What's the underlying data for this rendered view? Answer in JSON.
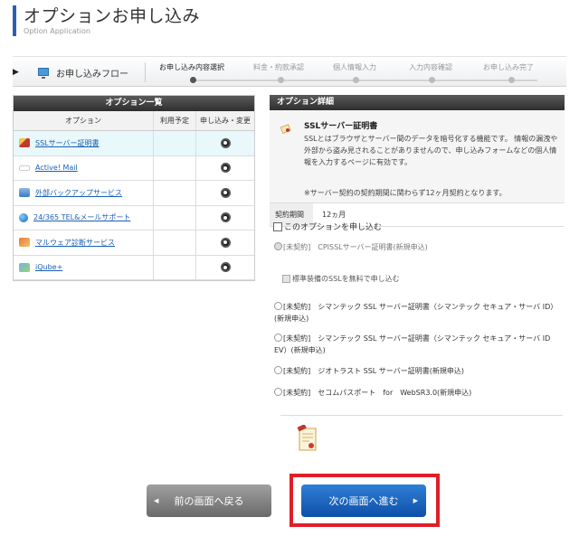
{
  "header": {
    "title": "オプションお申し込み",
    "subtitle": "Option Application"
  },
  "flow": {
    "label": "お申し込みフロー",
    "steps": [
      "お申し込み内容選択",
      "料金・約款承認",
      "個人情報入力",
      "入力内容確認",
      "お申し込み完了"
    ],
    "current_step": "お申し込み内容選択"
  },
  "options_panel": {
    "title": "オプション一覧",
    "columns": [
      "オプション",
      "利用予定",
      "申し込み・変更"
    ],
    "rows": [
      {
        "name": "SSLサーバー証明書",
        "icon": "certificate-icon",
        "selected": true
      },
      {
        "name": "Active! Mail",
        "icon": "active-mail-logo",
        "selected": false
      },
      {
        "name": "外部バックアップサービス",
        "icon": "backup-icon",
        "selected": false
      },
      {
        "name": "24/365 TEL&メールサポート",
        "icon": "support-globe-icon",
        "selected": false
      },
      {
        "name": "マルウェア診断サービス",
        "icon": "malware-scan-icon",
        "selected": false
      },
      {
        "name": "iQube+",
        "icon": "iqube-icon",
        "selected": false
      }
    ]
  },
  "detail_panel": {
    "title": "オプション詳細",
    "name": "SSLサーバー証明書",
    "description": "SSLとはブラウザとサーバー間のデータを暗号化する機能です。 情報の漏洩や外部から盗み見されることがありませんので、申し込みフォームなどの個人情報を入力するページに有効です。",
    "note": "※サーバー契約の契約期間に関わらず12ヶ月契約となります。",
    "contract_label": "契約期間",
    "contract_value": "12ヵ月",
    "apply_checkbox": "このオプションを申し込む",
    "choices": [
      {
        "label": "[未契約]　CPISSLサーバー証明書(新規申込)",
        "disabled": true
      },
      {
        "label": "[未契約]　シマンテック SSL サーバー証明書（シマンテック セキュア・サーバ ID）(新規申込)",
        "disabled": false
      },
      {
        "label": "[未契約]　シマンテック SSL サーバー証明書（シマンテック セキュア・サーバ ID EV）(新規申込)",
        "disabled": false
      },
      {
        "label": "[未契約]　ジオトラスト SSL サーバー証明書(新規申込)",
        "disabled": false
      },
      {
        "label": "[未契約]　セコムパスポート　for　WebSR3.0(新規申込)",
        "disabled": false
      }
    ],
    "standard_ssl_checkbox": "標準装備のSSLを無料で申し込む"
  },
  "buttons": {
    "back": "前の画面へ戻る",
    "next": "次の画面へ進む"
  },
  "colors": {
    "accent_blue": "#2a62b0",
    "highlight_red": "#e01e27",
    "header_dark": "#2e2e2e"
  }
}
